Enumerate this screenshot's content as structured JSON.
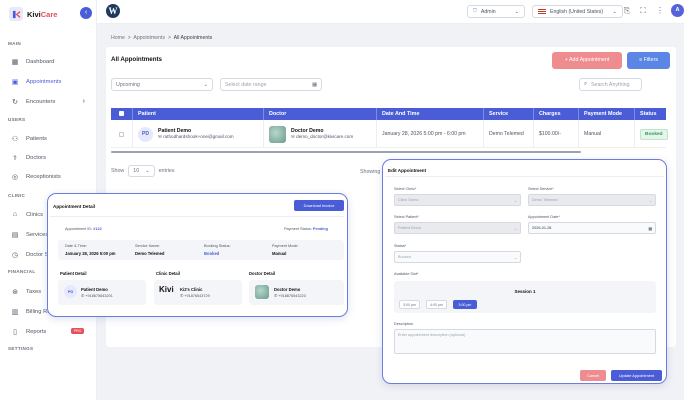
{
  "app": {
    "brand_a": "Kivi",
    "brand_b": "Care"
  },
  "sidebar": {
    "sections": {
      "main": "MAIN",
      "users": "USERS",
      "clinic": "CLINIC",
      "financial": "FINANCIAL",
      "settings": "SETTINGS"
    },
    "items": [
      {
        "label": "Dashboard",
        "icon": "dashboard-icon"
      },
      {
        "label": "Appointments",
        "icon": "calendar-icon"
      },
      {
        "label": "Encounters",
        "icon": "encounter-icon"
      },
      {
        "label": "Patients",
        "icon": "patients-icon"
      },
      {
        "label": "Doctors",
        "icon": "doctor-icon"
      },
      {
        "label": "Receptionists",
        "icon": "receptionist-icon"
      },
      {
        "label": "Clinics",
        "icon": "clinic-icon"
      },
      {
        "label": "Services",
        "icon": "services-icon"
      },
      {
        "label": "Doctor Se",
        "icon": "clock-icon"
      },
      {
        "label": "Taxes",
        "icon": "tax-icon"
      },
      {
        "label": "Billing Re",
        "icon": "billing-icon"
      },
      {
        "label": "Reports",
        "icon": "reports-icon"
      }
    ],
    "pro": "PRO"
  },
  "topbar": {
    "role": "Admin",
    "language": "English (United States)",
    "avatar": "A"
  },
  "breadcrumb": {
    "home": "Home",
    "sep": ">",
    "appointments": "Appointments",
    "all": "All Appointments"
  },
  "page": {
    "title": "All Appointments",
    "add_button": "+ Add Appointment",
    "filter_button": "Filters",
    "status_select": "Upcoming",
    "date_placeholder": "Select date range",
    "search_placeholder": "Search Anything"
  },
  "table": {
    "headers": [
      "Patient",
      "Doctor",
      "Date And Time",
      "Service",
      "Charges",
      "Payment Mode",
      "Status"
    ],
    "row": {
      "patient_initials": "PD",
      "patient_name": "Patient Demo",
      "patient_email": "rathodhardshook+one@gmail.com",
      "doctor_name": "Doctor Demo",
      "doctor_email": "demo_doctor@kivicare.com",
      "datetime": "January 28, 2026 5:00 pm - 6:00 pm",
      "service": "Demo Telemed",
      "charges": "$100.00/-",
      "payment_mode": "Manual",
      "status": "Booked"
    }
  },
  "pagination": {
    "show": "Show",
    "entries_value": "10",
    "entries": "entries",
    "showing": "Showing"
  },
  "detail": {
    "title": "Appointment Detail",
    "download": "Download Invoice",
    "id_label": "Appointment ID:",
    "id_value": "#122",
    "pay_label": "Payment Status:",
    "pay_value": "Pending",
    "fields": [
      {
        "label": "Date & Time:",
        "value": "January 28, 2026 5:00 pm"
      },
      {
        "label": "Service Name:",
        "value": "Demo Telemed"
      },
      {
        "label": "Booking Status:",
        "value": "Booked"
      },
      {
        "label": "Payment Mode:",
        "value": "Manual"
      }
    ],
    "patient_title": "Patient Detail",
    "clinic_title": "Clinic Detail",
    "doctor_title": "Doctor Detail",
    "patient": {
      "initials": "PD",
      "name": "Patient Demo",
      "phone": "+918675643201"
    },
    "clinic": {
      "logo": "Kivi",
      "name": "Ki2's Clinic",
      "phone": "+91876543729"
    },
    "doctor": {
      "name": "Doctor Demo",
      "phone": "+918876543223"
    }
  },
  "edit": {
    "title": "Edit Appointment",
    "clinic_label": "Select Clinic*",
    "clinic_value": "Clinic Demo",
    "service_label": "Select Service*",
    "service_value": "Demo Telemed",
    "patient_label": "Select Patient*",
    "patient_value": "Patient Demo",
    "date_label": "Appointment Date*",
    "date_value": "2026-01-28",
    "status_label": "Status*",
    "status_value": "Booked",
    "slot_label": "Available Slot*",
    "session": "Session 1",
    "slots": [
      "3:00 pm",
      "4:00 pm",
      "5:00 pm"
    ],
    "desc_label": "Description",
    "desc_placeholder": "Enter appointment description (optional)",
    "cancel": "Cancel",
    "update": "Update Appointment"
  }
}
